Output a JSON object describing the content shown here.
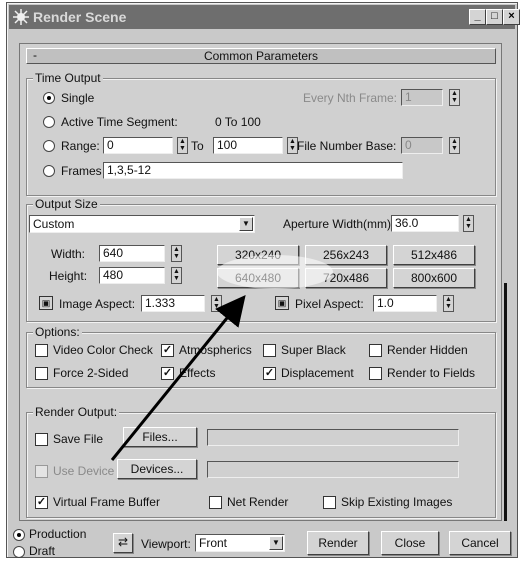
{
  "window": {
    "title": "Render Scene",
    "minimize": "_",
    "maximize": "□",
    "close": "×"
  },
  "rollout": {
    "title": "Common Parameters",
    "collapse": "-"
  },
  "time_output": {
    "label": "Time Output",
    "single": "Single",
    "active_segment": "Active Time Segment:",
    "active_segment_value": "0 To 100",
    "range": "Range:",
    "range_from": "0",
    "to": "To",
    "range_to": "100",
    "frames": "Frames",
    "frames_value": "1,3,5-12",
    "every_nth": "Every Nth Frame:",
    "every_nth_value": "1",
    "file_number_base": "File Number Base:",
    "file_number_base_value": "0"
  },
  "output_size": {
    "label": "Output Size",
    "preset": "Custom",
    "aperture_label": "Aperture Width(mm):",
    "aperture_value": "36.0",
    "width_label": "Width:",
    "width_value": "640",
    "height_label": "Height:",
    "height_value": "480",
    "presets": [
      "320x240",
      "256x243",
      "512x486",
      "640x480",
      "720x486",
      "800x600"
    ],
    "image_aspect_label": "Image Aspect:",
    "image_aspect_value": "1.333",
    "pixel_aspect_label": "Pixel Aspect:",
    "pixel_aspect_value": "1.0"
  },
  "options": {
    "label": "Options:",
    "video_color_check": "Video Color Check",
    "atmospherics": "Atmospherics",
    "super_black": "Super Black",
    "render_hidden": "Render Hidden",
    "force_2sided": "Force 2-Sided",
    "effects": "Effects",
    "displacement": "Displacement",
    "render_to_fields": "Render to Fields"
  },
  "render_output": {
    "label": "Render Output:",
    "save_file": "Save File",
    "files_button": "Files...",
    "use_device": "Use Device",
    "devices_button": "Devices...",
    "virtual_frame_buffer": "Virtual Frame Buffer",
    "net_render": "Net Render",
    "skip_existing": "Skip Existing Images"
  },
  "bottom": {
    "production": "Production",
    "draft": "Draft",
    "viewport_label": "Viewport:",
    "viewport_value": "Front",
    "render": "Render",
    "close": "Close",
    "cancel": "Cancel"
  }
}
